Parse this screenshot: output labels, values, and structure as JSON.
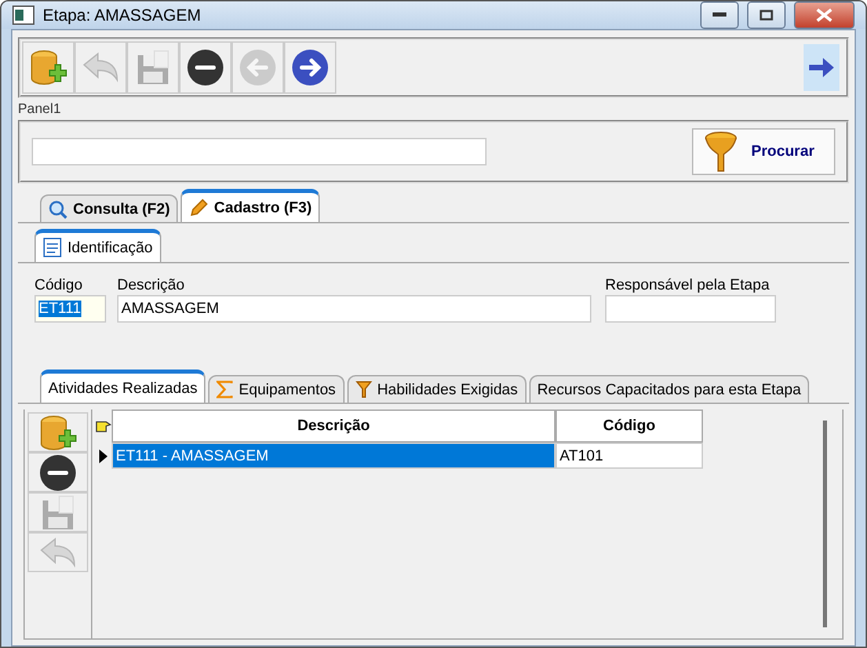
{
  "window": {
    "title": "Etapa: AMASSAGEM"
  },
  "toolbar": {
    "buttons": [
      {
        "kind": "add",
        "disabled": false
      },
      {
        "kind": "undo",
        "disabled": true
      },
      {
        "kind": "save",
        "disabled": true
      },
      {
        "kind": "remove",
        "disabled": false
      },
      {
        "kind": "back",
        "disabled": true
      },
      {
        "kind": "forward",
        "disabled": false
      }
    ]
  },
  "panel": {
    "caption": "Panel1",
    "search_button": "Procurar"
  },
  "tabs": [
    {
      "label": "Consulta (F2)",
      "kind": "search",
      "selected": false
    },
    {
      "label": "Cadastro (F3)",
      "kind": "edit",
      "selected": true
    }
  ],
  "subtabs": [
    {
      "label": "Identificação",
      "selected": true
    }
  ],
  "fields": [
    {
      "label": "Código",
      "value": "ET111",
      "kind": "code"
    },
    {
      "label": "Descrição",
      "value": "AMASSAGEM",
      "kind": "wide"
    },
    {
      "label": "Responsável pela Etapa",
      "kind": "medium"
    }
  ],
  "detail_tabs": [
    {
      "label": "Atividades Realizadas",
      "kind": "plain",
      "selected": true
    },
    {
      "label": "Equipamentos",
      "kind": "sigma",
      "selected": false
    },
    {
      "label": "Habilidades Exigidas",
      "kind": "filter",
      "selected": false
    },
    {
      "label": "Recursos Capacitados para esta Etapa",
      "kind": "plain",
      "selected": false
    }
  ],
  "side_buttons": [
    {
      "kind": "add",
      "disabled": false
    },
    {
      "kind": "remove",
      "disabled": false
    },
    {
      "kind": "save",
      "disabled": true
    },
    {
      "kind": "undo",
      "disabled": true
    }
  ],
  "table": {
    "columns": [
      "Descrição",
      "Código"
    ],
    "rows": [
      {
        "cells": [
          "ET111 - AMASSAGEM",
          "AT101"
        ],
        "selected": true
      }
    ]
  }
}
